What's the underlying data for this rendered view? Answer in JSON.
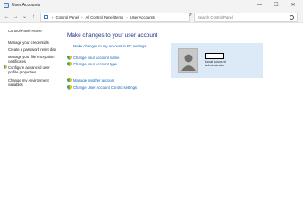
{
  "window": {
    "title": "User Accounts",
    "controls": {
      "minimize": "—",
      "maximize": "☐",
      "close": "✕"
    }
  },
  "address": {
    "breadcrumbs": [
      "Control Panel",
      "All Control Panel Items",
      "User Accounts"
    ],
    "separator": "›",
    "dropdown_glyph": "⌄",
    "refresh_glyph": "⟳",
    "nav": {
      "back": "←",
      "forward": "→",
      "dropdown": "⌄",
      "up": "↑"
    }
  },
  "search": {
    "placeholder": "Search Control Panel"
  },
  "left_pane": {
    "items": [
      "Control Panel Home",
      "Manage your credentials",
      "Create a password reset disk",
      "Manage your file encryption certificates",
      "Configure advanced user profile properties",
      "Change my environment variables"
    ]
  },
  "main": {
    "heading": "Make changes to your user account",
    "pc_settings_link": "Make changes to my account in PC settings",
    "links_group1": [
      "Change your account name",
      "Change your account type"
    ],
    "links_group2": [
      "Manage another account",
      "Change User Account Control settings"
    ]
  },
  "account": {
    "type": "Local Account",
    "role": "Administrator"
  },
  "colors": {
    "link": "#0a5fb4",
    "heading": "#1e3287",
    "tile_bg": "#dce9f7"
  }
}
